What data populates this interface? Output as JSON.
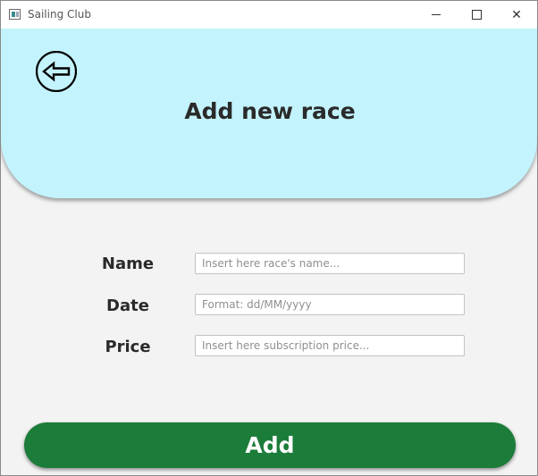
{
  "window": {
    "title": "Sailing Club",
    "controls": {
      "minimize_icon": "minimize-icon",
      "maximize_icon": "maximize-icon",
      "close_icon": "close-icon",
      "close_glyph": "✕"
    }
  },
  "header": {
    "title": "Add new race",
    "back_icon": "arrow-left-circle-icon",
    "background_color": "#c3f3fd"
  },
  "form": {
    "name": {
      "label": "Name",
      "value": "",
      "placeholder": "Insert here race's name..."
    },
    "date": {
      "label": "Date",
      "value": "",
      "placeholder": "Format: dd/MM/yyyy"
    },
    "price": {
      "label": "Price",
      "value": "",
      "placeholder": "Insert here subscription price..."
    }
  },
  "actions": {
    "add_label": "Add",
    "add_color": "#1c7c39"
  }
}
